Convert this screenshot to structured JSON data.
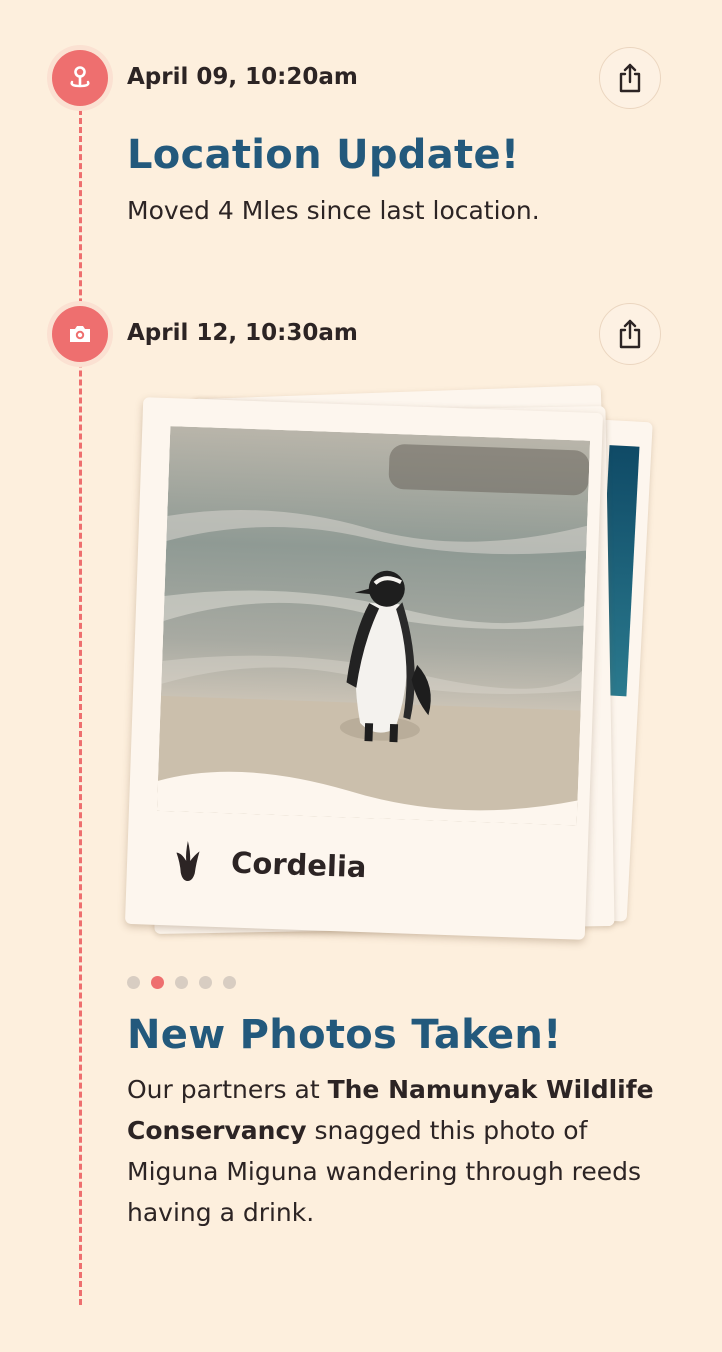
{
  "colors": {
    "background": "#fdefdd",
    "accent": "#ee6f6f",
    "heading": "#23597c",
    "text": "#2c2424"
  },
  "timeline": [
    {
      "icon": "location-pin-icon",
      "timestamp": "April 09, 10:20am",
      "share_icon": "share-icon",
      "title": "Location Update!",
      "description": "Moved 4 Mles since last location."
    },
    {
      "icon": "camera-icon",
      "timestamp": "April 12, 10:30am",
      "share_icon": "share-icon",
      "photo": {
        "caption_icon": "footprint-icon",
        "caption": "Cordelia"
      },
      "carousel": {
        "count": 5,
        "active_index": 1
      },
      "title": "New Photos Taken!",
      "description": {
        "part1": "Our partners at ",
        "bold": "The Namunyak Wildlife Conservancy",
        "part2": " snagged this photo of Miguna Miguna wandering through reeds having a drink."
      }
    }
  ]
}
